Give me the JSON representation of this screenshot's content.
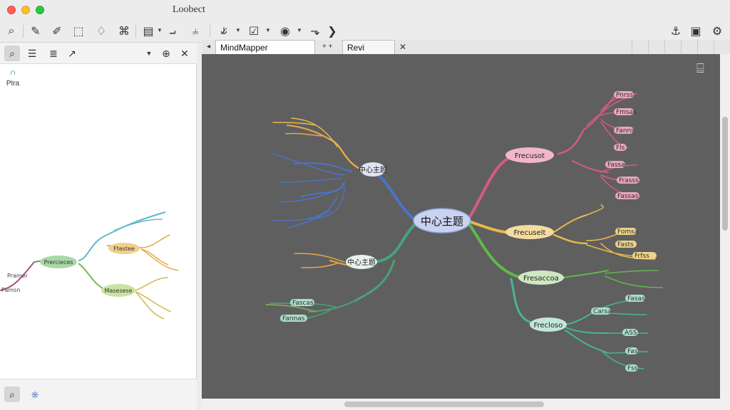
{
  "window": {
    "title": "Loobect"
  },
  "tabs": [
    {
      "label": "MindMapper  MindMapper",
      "active": true
    },
    {
      "label": "Revi Setioh",
      "active": false
    }
  ],
  "tab_extra": "+ +",
  "left_panel": {
    "thumb_label": "Ptra"
  },
  "main_map": {
    "center": "中心主题",
    "branches": [
      {
        "label": "中心主题",
        "color": "#4a74c9"
      },
      {
        "label": "中心主题",
        "color": "#48a37a"
      },
      {
        "label": "Frecusot",
        "color": "#d45b83"
      },
      {
        "label": "Frecuselt",
        "color": "#e6b94b"
      },
      {
        "label": "Fresaccoa",
        "color": "#5fb94a"
      },
      {
        "label": "Frecloso",
        "color": "#49b58f"
      }
    ],
    "leaves_right_pink": [
      "Pnrss",
      "Fmsas",
      "Fanns",
      "Fls",
      "Fassa",
      "Frasss",
      "Fassas"
    ],
    "leaves_right_yellow": [
      "Fomsa",
      "Fasts",
      "Frfss"
    ],
    "leaves_right_teal": [
      "Carsa",
      "Fasas",
      "ASS",
      "Fas",
      "Fss"
    ],
    "leaves_left_teal": [
      "Fascas",
      "Fannas"
    ]
  },
  "mini_map": {
    "nodes": [
      "Prercieces",
      "Ftestee",
      "Masesese",
      "Pramer",
      "Pamsn"
    ]
  }
}
